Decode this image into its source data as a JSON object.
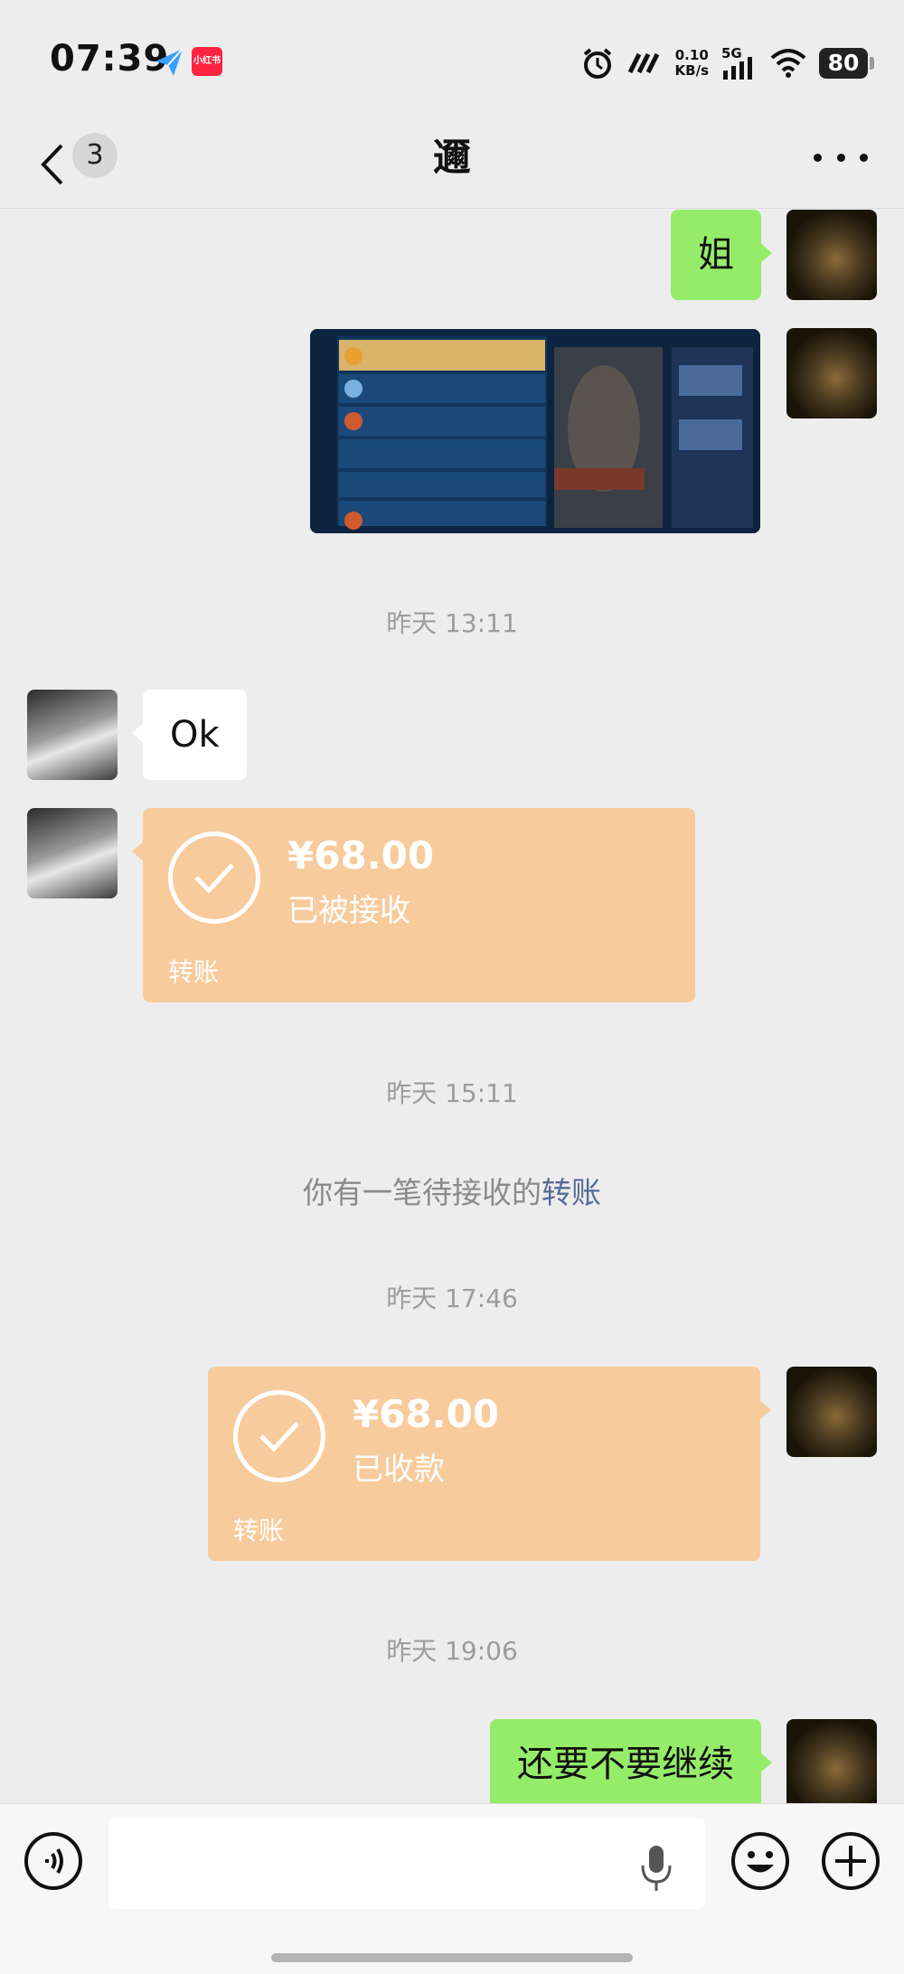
{
  "status_bar": {
    "time": "07:39",
    "app2_label": "小红书",
    "net_speed_value": "0.10",
    "net_speed_unit": "KB/s",
    "network": "5G",
    "battery": "80"
  },
  "nav": {
    "unread_count": "3",
    "title": "邇"
  },
  "messages": {
    "m1_text": "姐",
    "ts1": "昨天 13:11",
    "m3_text": "Ok",
    "t1_amount": "¥68.00",
    "t1_status": "已被接收",
    "t1_label": "转账",
    "ts2": "昨天 15:11",
    "sys_prefix": "你有一笔待接收的",
    "sys_link": "转账",
    "ts3": "昨天 17:46",
    "t2_amount": "¥68.00",
    "t2_status": "已收款",
    "t2_label": "转账",
    "ts4": "昨天 19:06",
    "m6_text": "还要不要继续"
  },
  "input_bar": {
    "voice_icon": "voice-icon",
    "mic_icon": "mic-icon",
    "emoji_icon": "emoji-icon",
    "plus_icon": "plus-icon"
  },
  "colors": {
    "bg": "#ededed",
    "sent_bubble": "#95ec69",
    "transfer_card": "#f8cb9c",
    "link": "#576b95"
  }
}
